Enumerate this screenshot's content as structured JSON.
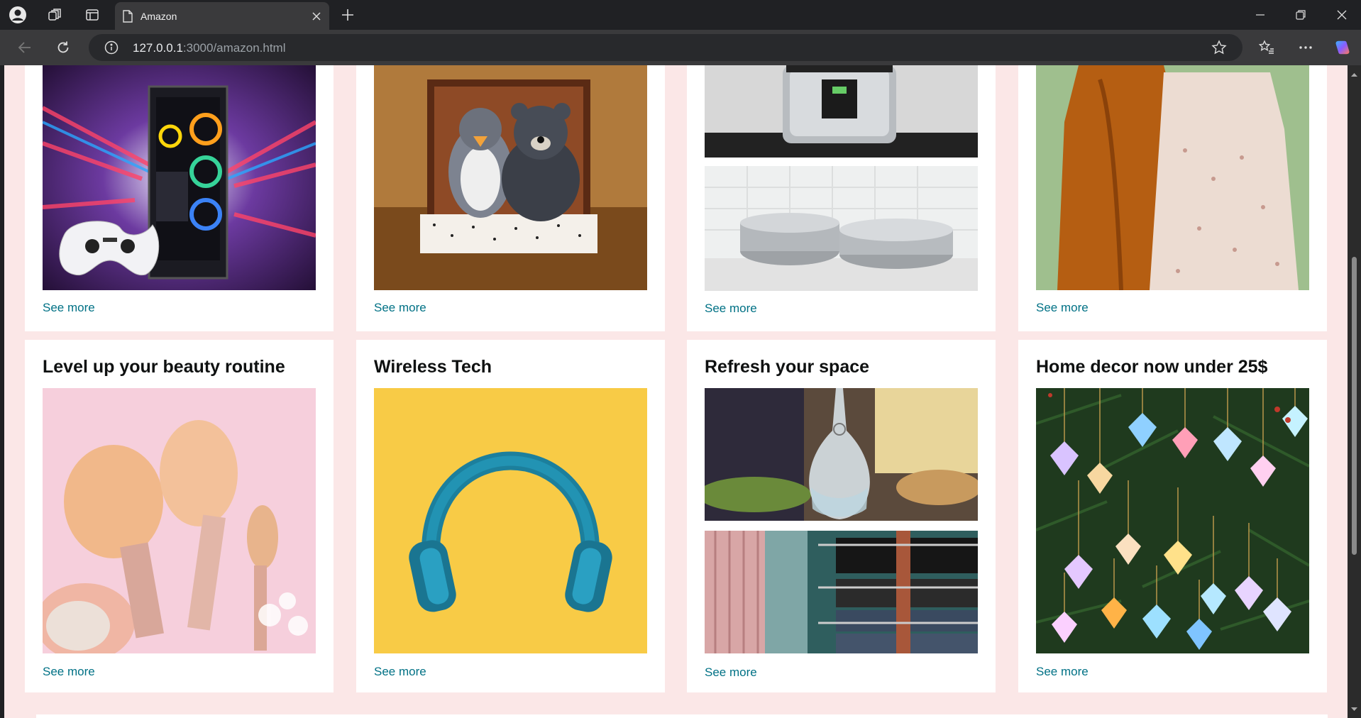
{
  "browser": {
    "tab_title": "Amazon",
    "url_host": "127.0.0.1",
    "url_path": ":3000/amazon.html"
  },
  "cards_top": [
    {
      "see_more": "See more",
      "image": "gaming-pc"
    },
    {
      "see_more": "See more",
      "image": "plush-toys"
    },
    {
      "see_more": "See more",
      "image": "kitchen"
    },
    {
      "see_more": "See more",
      "image": "dresses"
    }
  ],
  "cards_bottom": [
    {
      "title": "Level up your beauty routine",
      "see_more": "See more",
      "image": "makeup-brushes"
    },
    {
      "title": "Wireless Tech",
      "see_more": "See more",
      "image": "headphones"
    },
    {
      "title": "Refresh your space",
      "see_more": "See more",
      "image": "home-space"
    },
    {
      "title": "Home decor now under 25$",
      "see_more": "See more",
      "image": "ornaments"
    }
  ],
  "colors": {
    "page_bg": "#fbe7e7",
    "link": "#007185",
    "heading": "#0f1111"
  }
}
